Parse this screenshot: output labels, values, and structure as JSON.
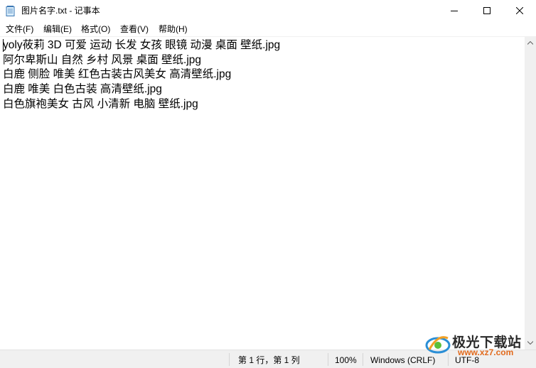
{
  "window": {
    "title": "图片名字.txt - 记事本"
  },
  "menu": {
    "file": "文件(F)",
    "edit": "编辑(E)",
    "format": "格式(O)",
    "view": "查看(V)",
    "help": "帮助(H)"
  },
  "document": {
    "lines": [
      "yoly莜莉 3D 可爱 运动 长发 女孩 眼镜 动漫 桌面 壁纸.jpg",
      "阿尔卑斯山 自然 乡村 风景 桌面 壁纸.jpg",
      "白鹿 侧脸 唯美 红色古装古风美女 高清壁纸.jpg",
      "白鹿 唯美 白色古装 高清壁纸.jpg",
      "白色旗袍美女 古风 小清新 电脑 壁纸.jpg"
    ]
  },
  "status": {
    "position": "第 1 行，第 1 列",
    "zoom": "100%",
    "line_ending": "Windows (CRLF)",
    "encoding": "UTF-8"
  },
  "watermark": {
    "title": "极光下载站",
    "url": "www.xz7.com"
  },
  "colors": {
    "statusbar_bg": "#f0f0f0",
    "watermark_url": "#e26a1c"
  }
}
